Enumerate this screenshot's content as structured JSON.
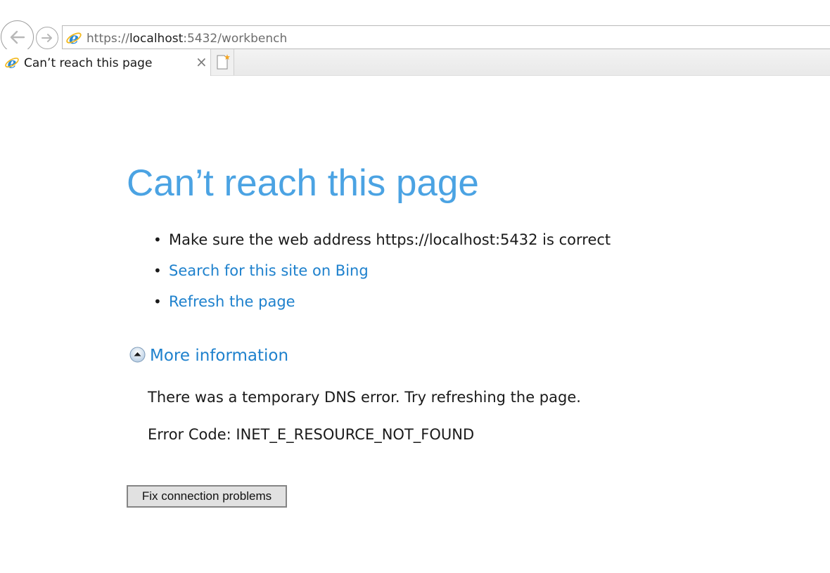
{
  "browser": {
    "url_scheme": "https://",
    "url_host": "localhost",
    "url_rest": ":5432/workbench",
    "tab": {
      "title": "Can’t reach this page",
      "close_glyph": "×"
    },
    "icons": {
      "back": "back-arrow-icon",
      "forward": "forward-arrow-icon",
      "site": "internet-explorer-icon",
      "new_tab": "new-tab-icon"
    }
  },
  "page": {
    "heading": "Can’t reach this page",
    "suggestions": [
      {
        "text": "Make sure the web address https://localhost:5432 is correct",
        "is_link": false
      },
      {
        "text": "Search for this site on Bing",
        "is_link": true
      },
      {
        "text": "Refresh the page",
        "is_link": true
      }
    ],
    "bullet": "•",
    "more_info": {
      "label": "More information",
      "icon": "collapse-up-icon",
      "dns_message": "There was a temporary DNS error. Try refreshing the page.",
      "error_code": "Error Code: INET_E_RESOURCE_NOT_FOUND"
    },
    "fix_button_label": "Fix connection problems"
  },
  "colors": {
    "heading": "#4ba3e3",
    "link": "#1e81cd",
    "text": "#1a1a1a"
  }
}
